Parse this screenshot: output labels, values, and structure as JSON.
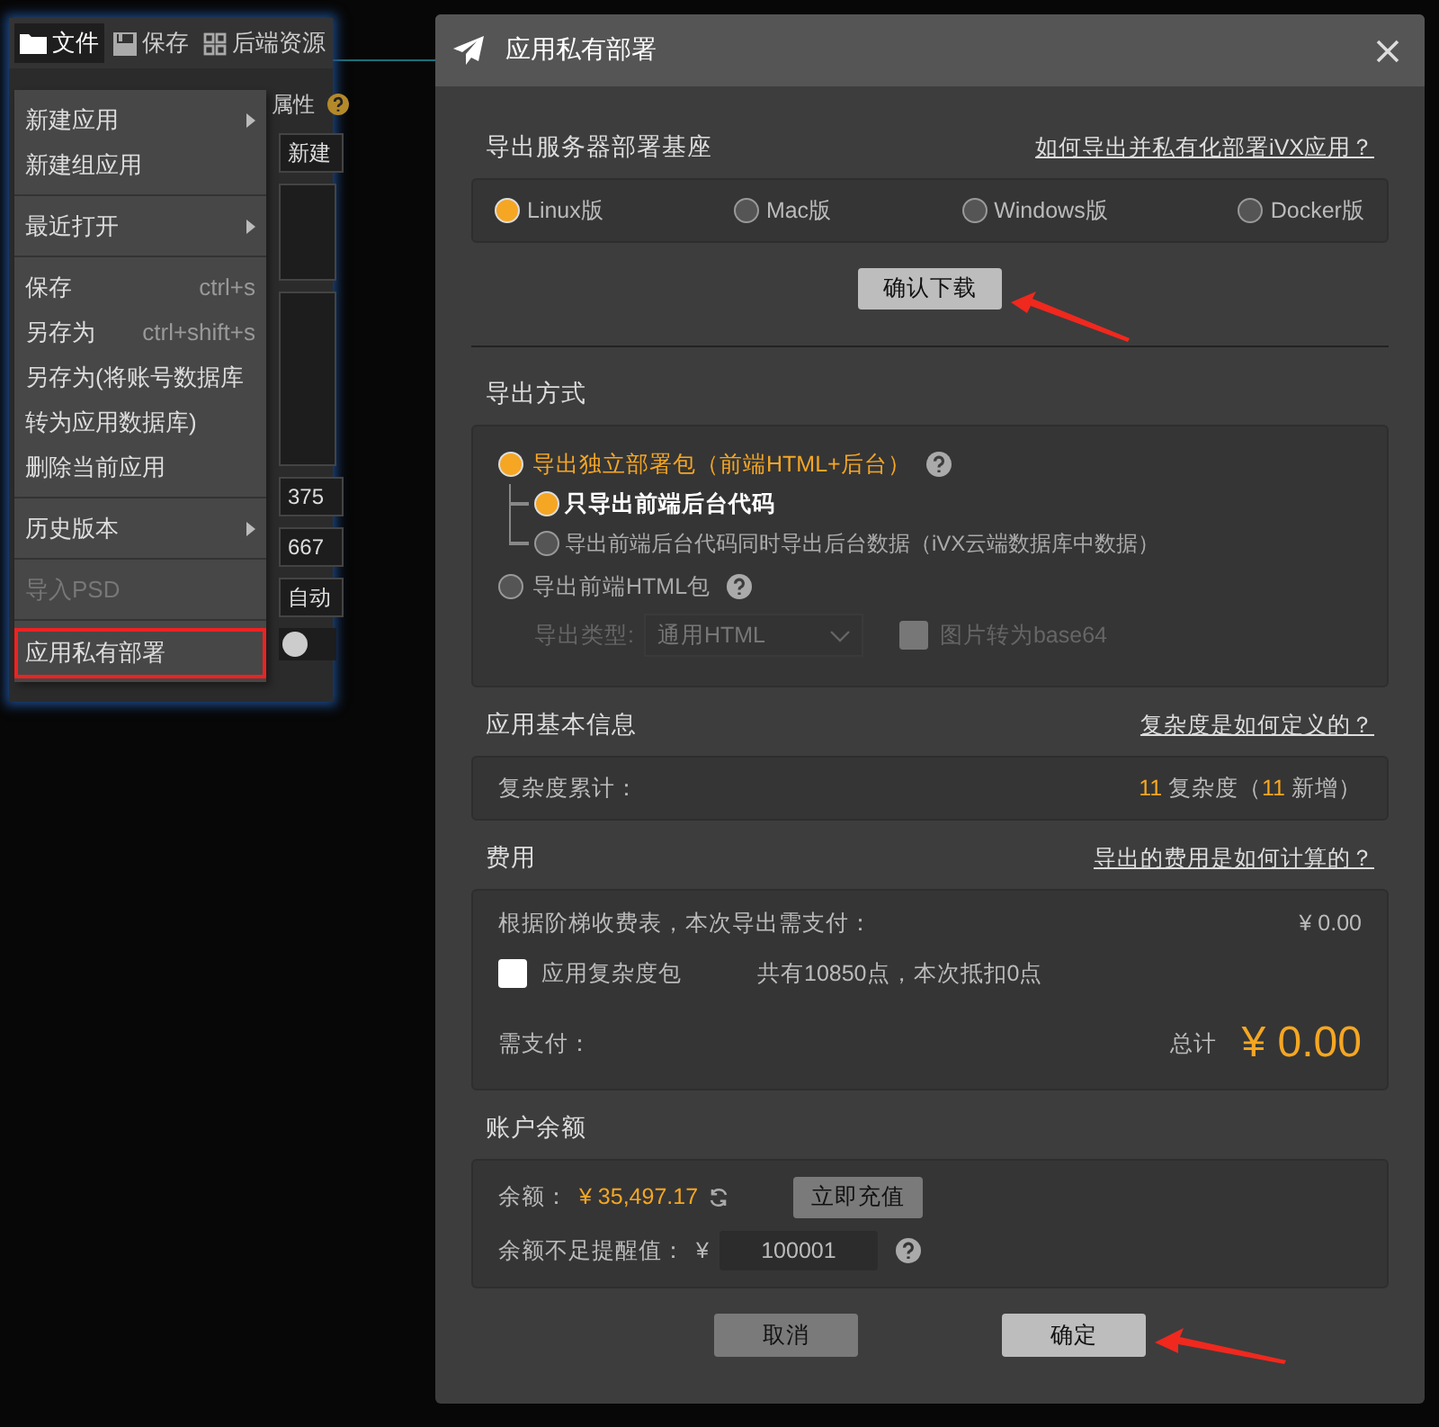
{
  "toolbar": [
    {
      "label": "文件",
      "selected": true
    },
    {
      "label": "保存",
      "selected": false
    },
    {
      "label": "后端资源",
      "selected": false
    }
  ],
  "background_panel": {
    "heading": "属性",
    "fields": [
      "新建",
      "375",
      "667",
      "自动"
    ],
    "toggle_on": false
  },
  "file_menu": {
    "groups": [
      [
        {
          "label": "新建应用",
          "submenu": true,
          "disabled": false,
          "highlighted": false
        },
        {
          "label": "新建组应用",
          "submenu": false,
          "disabled": false,
          "highlighted": false
        }
      ],
      [
        {
          "label": "最近打开",
          "submenu": true,
          "disabled": false,
          "highlighted": false
        }
      ],
      [
        {
          "label": "保存",
          "shortcut": "ctrl+s",
          "submenu": false,
          "disabled": false,
          "highlighted": false
        },
        {
          "label": "另存为",
          "shortcut": "ctrl+shift+s",
          "submenu": false,
          "disabled": false,
          "highlighted": false
        },
        {
          "label": "另存为(将账号数据库",
          "submenu": false,
          "disabled": false,
          "highlighted": false
        },
        {
          "label": "转为应用数据库)",
          "submenu": false,
          "disabled": false,
          "highlighted": false
        },
        {
          "label": "删除当前应用",
          "submenu": false,
          "disabled": false,
          "highlighted": false
        }
      ],
      [
        {
          "label": "历史版本",
          "submenu": true,
          "disabled": false,
          "highlighted": false
        }
      ],
      [
        {
          "label": "导入PSD",
          "submenu": false,
          "disabled": true,
          "highlighted": false
        }
      ],
      [
        {
          "label": "应用私有部署",
          "submenu": false,
          "disabled": false,
          "highlighted": true
        }
      ]
    ]
  },
  "dialog": {
    "title": "应用私有部署",
    "server": {
      "heading": "导出服务器部署基座",
      "link": "如何导出并私有化部署iVX应用？",
      "options": [
        {
          "label": "Linux版",
          "selected": true
        },
        {
          "label": "Mac版",
          "selected": false
        },
        {
          "label": "Windows版",
          "selected": false
        },
        {
          "label": "Docker版",
          "selected": false
        }
      ],
      "button": "确认下载"
    },
    "export": {
      "heading": "导出方式",
      "options": [
        {
          "label": "导出独立部署包（前端HTML+后台）",
          "selected": true,
          "children": [
            {
              "label": "只导出前端后台代码",
              "selected": true
            },
            {
              "label": "导出前端后台代码同时导出后台数据（iVX云端数据库中数据）",
              "selected": false
            }
          ]
        },
        {
          "label": "导出前端HTML包",
          "selected": false
        }
      ],
      "type_label": "导出类型:",
      "type_value": "通用HTML",
      "base64": {
        "label": "图片转为base64",
        "checked": false
      }
    },
    "info": {
      "heading": "应用基本信息",
      "link": "复杂度是如何定义的？",
      "label": "复杂度累计：",
      "total": "11",
      "unit": "复杂度（",
      "added": "11",
      "added_suffix": "新增）"
    },
    "fee": {
      "heading": "费用",
      "link": "导出的费用是如何计算的？",
      "tier_label": "根据阶梯收费表，本次导出需支付：",
      "tier_amount": "¥ 0.00",
      "package": {
        "label": "应用复杂度包",
        "checked": false
      },
      "package_note": "共有10850点，本次抵扣0点",
      "pay_label": "需支付：",
      "total_label": "总计",
      "total": "¥ 0.00"
    },
    "balance": {
      "heading": "账户余额",
      "label": "余额：",
      "amount": "¥ 35,497.17",
      "recharge": "立即充值",
      "alert_label": "余额不足提醒值：",
      "currency": "¥",
      "alert_value": "100001"
    },
    "buttons": [
      {
        "label": "取消",
        "primary": false
      },
      {
        "label": "确定",
        "primary": true
      }
    ]
  }
}
